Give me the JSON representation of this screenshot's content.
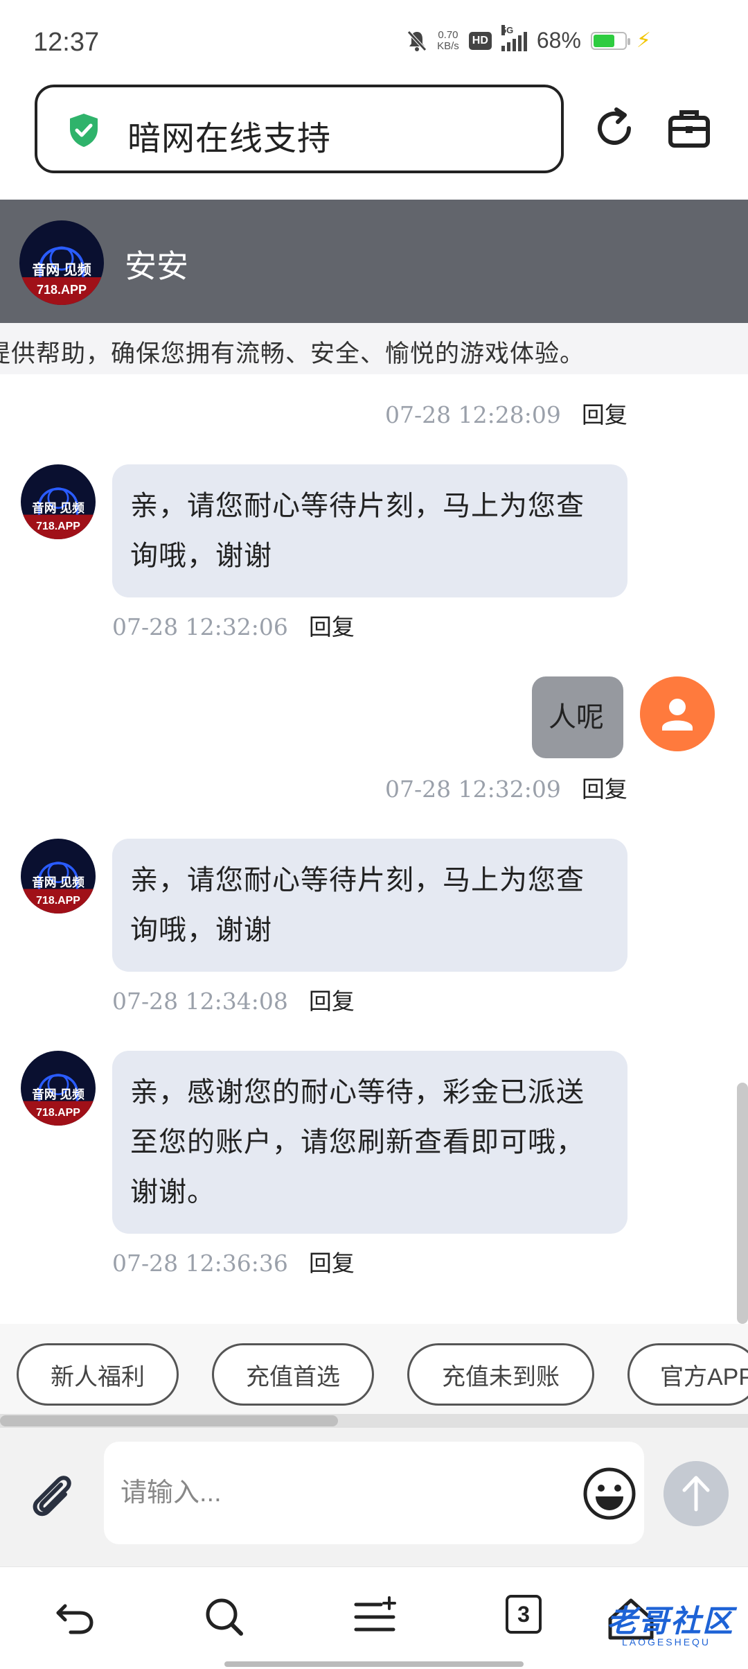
{
  "status_bar": {
    "time": "12:37",
    "net_speed_value": "0.70",
    "net_speed_unit": "KB/s",
    "hd": "HD",
    "network": "5G",
    "battery": "68%",
    "battery_level": 0.68,
    "icons": [
      "bell-muted-icon",
      "hd-icon",
      "signal-icon",
      "battery-icon",
      "charging-bolt-icon"
    ]
  },
  "browser": {
    "url_title": "暗网在线支持",
    "icons": [
      "shield-check-icon",
      "reload-icon",
      "toolbox-icon"
    ]
  },
  "chat_header": {
    "agent_name": "安安",
    "avatar_text_line1": "音网 见频",
    "avatar_text_line2": "718.APP"
  },
  "notice": {
    "text": "提供帮助，确保您拥有流畅、安全、愉悦的游戏体验。"
  },
  "messages": [
    {
      "side": "right",
      "text": "",
      "time": "07-28 12:28:09",
      "reply_label": "回复"
    },
    {
      "side": "left",
      "text": "亲，请您耐心等待片刻，马上为您查询哦，谢谢",
      "time": "07-28 12:32:06",
      "reply_label": "回复"
    },
    {
      "side": "right",
      "text": "人呢",
      "time": "07-28 12:32:09",
      "reply_label": "回复"
    },
    {
      "side": "left",
      "text": "亲，请您耐心等待片刻，马上为您查询哦，谢谢",
      "time": "07-28 12:34:08",
      "reply_label": "回复"
    },
    {
      "side": "left",
      "text": "亲，感谢您的耐心等待，彩金已派送至您的账户，请您刷新查看即可哦，谢谢。",
      "time": "07-28 12:36:36",
      "reply_label": "回复"
    }
  ],
  "quick_replies": [
    "新人福利",
    "充值首选",
    "充值未到账",
    "官方APP"
  ],
  "input": {
    "placeholder": "请输入...",
    "icons": [
      "paperclip-icon",
      "emoji-icon",
      "send-arrow-icon"
    ]
  },
  "bottom_nav": {
    "tab_count": "3",
    "watermark": "老哥社区",
    "watermark_sub": "LAOGESHEQU",
    "icons": [
      "back-icon",
      "search-icon",
      "menu-icon",
      "tabs-icon",
      "home-icon"
    ]
  },
  "colors": {
    "header_bg": "#62656c",
    "left_bubble": "#e5e9f2",
    "right_bubble": "#96999f",
    "user_avatar": "#ff7a3d",
    "shield": "#2fb36b",
    "timestamp": "#9aa0aa"
  }
}
